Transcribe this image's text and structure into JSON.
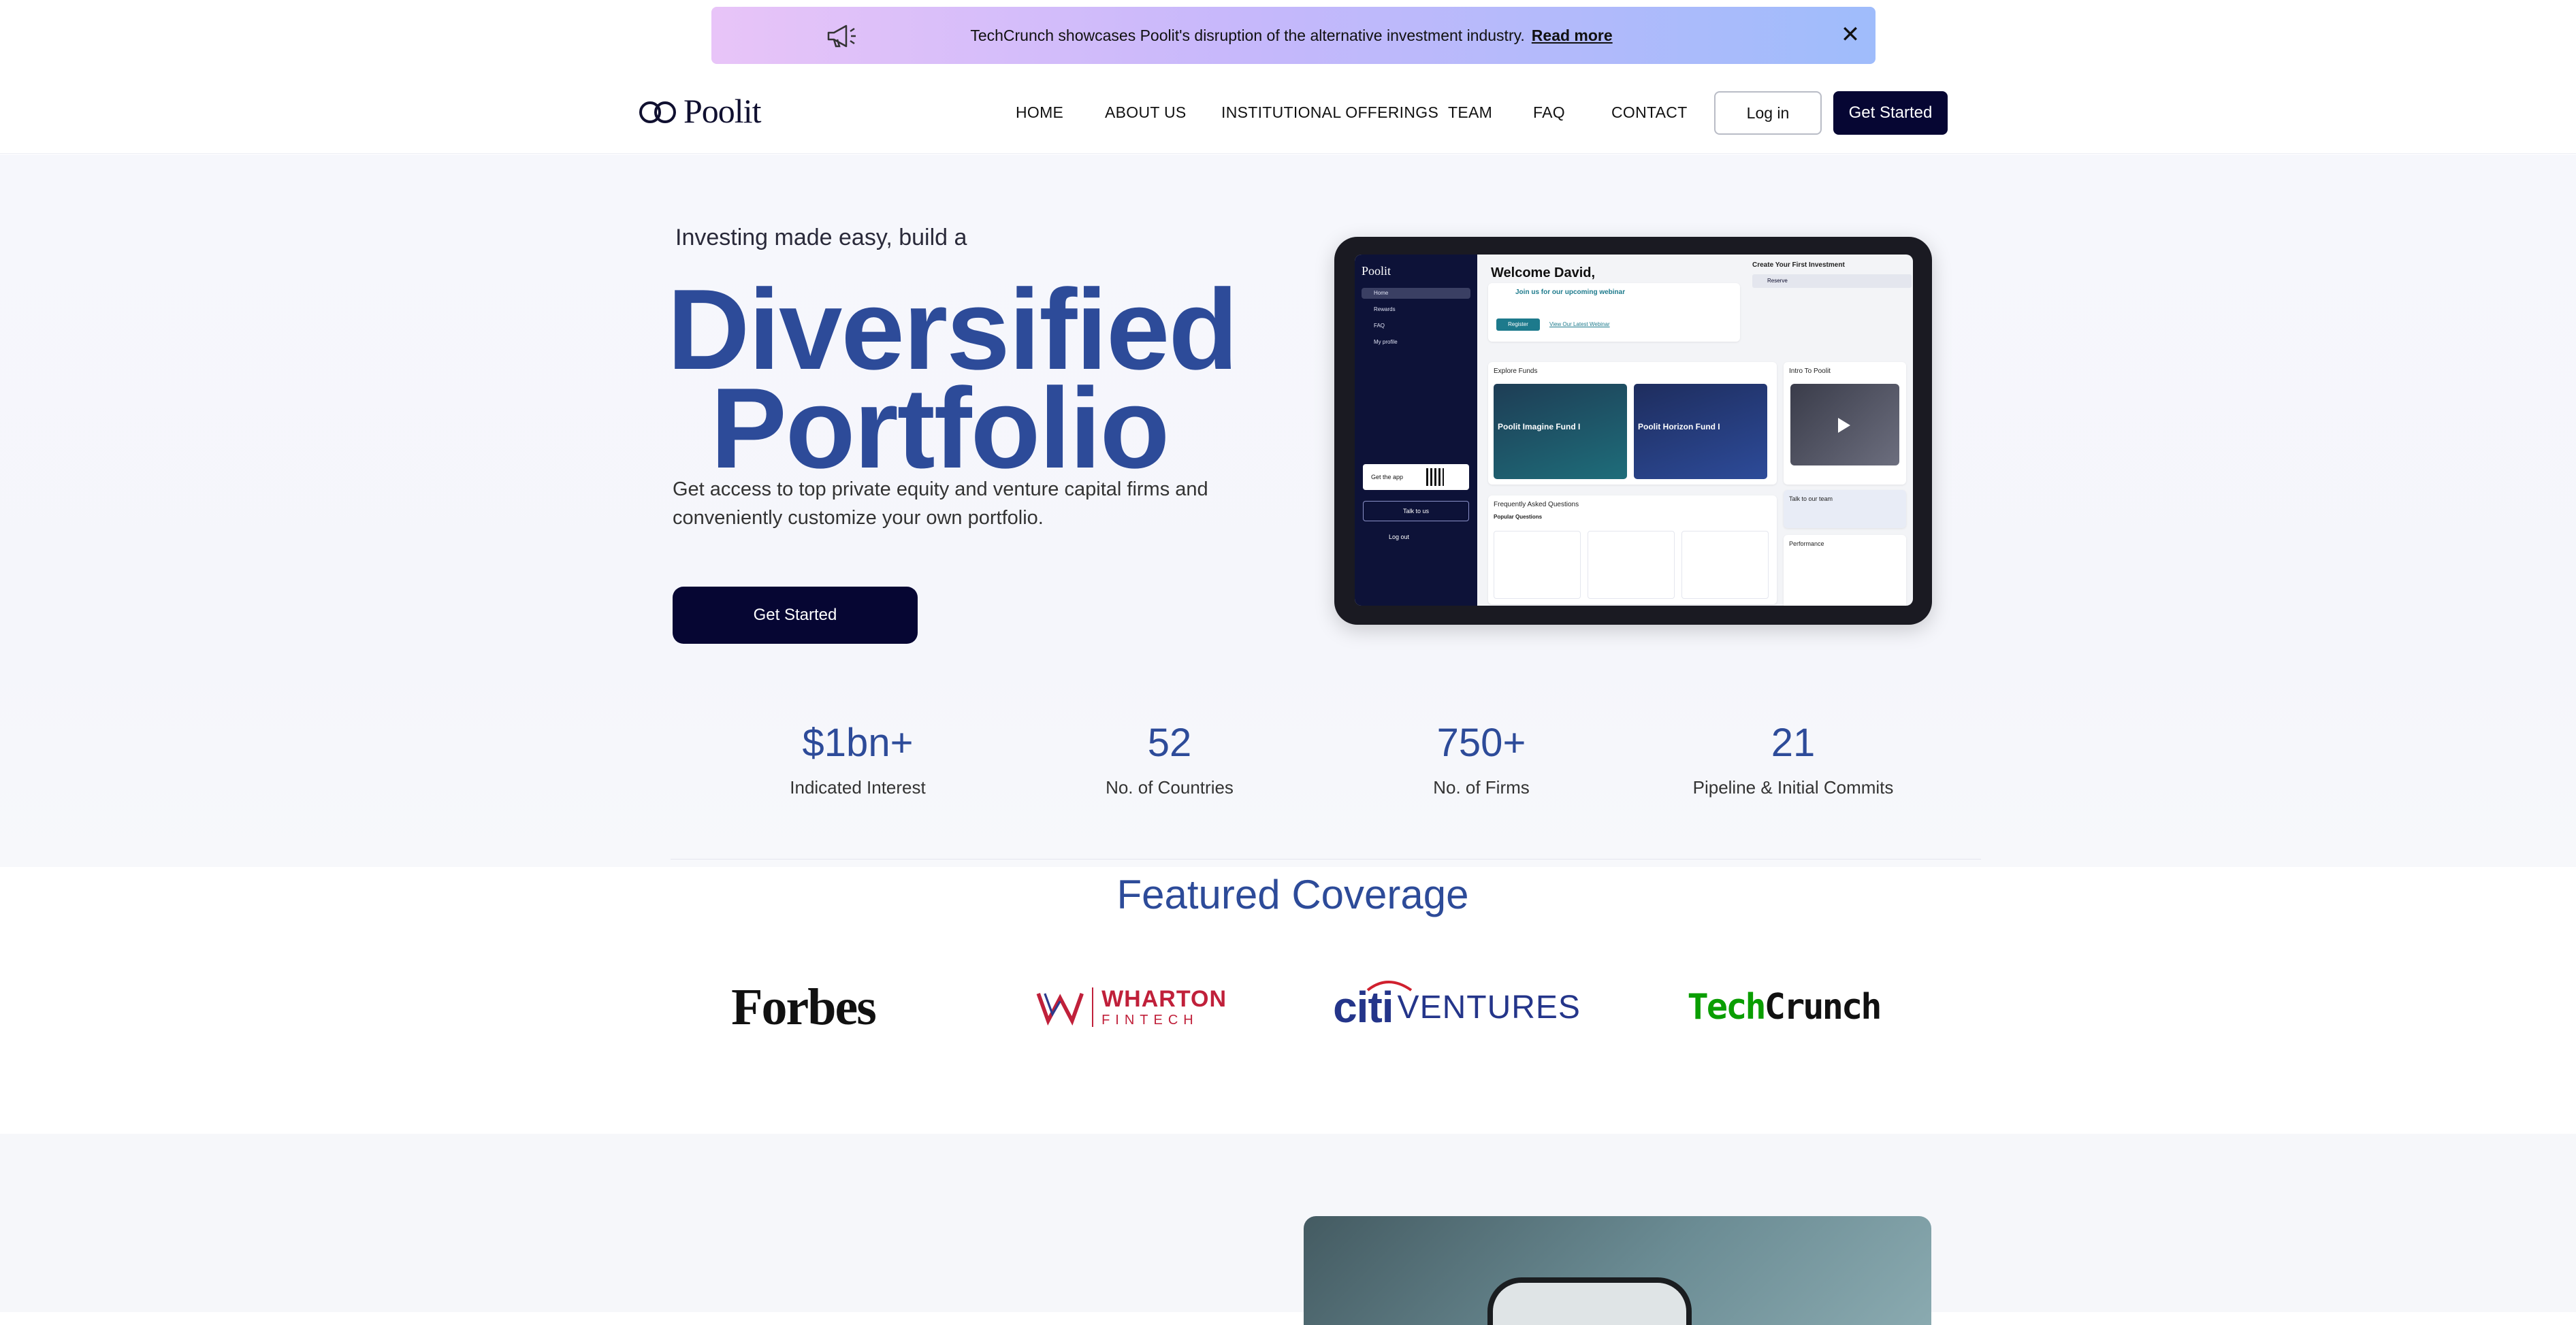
{
  "banner": {
    "text": "TechCrunch showcases Poolit's disruption of the alternative investment industry.",
    "link": "Read more",
    "close": "✕"
  },
  "brand": {
    "name": "Poolit"
  },
  "nav": {
    "items": [
      "HOME",
      "ABOUT US",
      "INSTITUTIONAL OFFERINGS",
      "TEAM",
      "FAQ",
      "CONTACT"
    ],
    "login": "Log in",
    "get_started": "Get Started"
  },
  "hero": {
    "tagline": "Investing made easy, build a",
    "headline_1": "Diversified",
    "headline_2": "Portfolio",
    "description": "Get access to top private equity and venture capital firms and conveniently customize your own portfolio.",
    "cta": "Get Started"
  },
  "mockup": {
    "logo": "Poolit",
    "sidebar": [
      "Home",
      "Rewards",
      "FAQ",
      "My profile"
    ],
    "get_app": "Get the app",
    "talk": "Talk to us",
    "logout": "Log out",
    "welcome": "Welcome David,",
    "webinar": "Join us for our upcoming webinar",
    "register": "Register",
    "view_webinar": "View Our Latest Webinar",
    "create_title": "Create Your First Investment",
    "reserve": "Reserve",
    "explore": "Explore Funds",
    "fund_1": "Poolit Imagine Fund I",
    "fund_2": "Poolit Horizon Fund I",
    "intro": "Intro To Poolit",
    "faq_title": "Frequently Asked Questions",
    "popular": "Popular Questions",
    "talk_team": "Talk to our team",
    "performance": "Performance"
  },
  "stats": [
    {
      "value": "$1bn+",
      "label": "Indicated Interest"
    },
    {
      "value": "52",
      "label": "No. of Countries"
    },
    {
      "value": "750+",
      "label": "No. of Firms"
    },
    {
      "value": "21",
      "label": "Pipeline & Initial Commits"
    }
  ],
  "coverage": {
    "title": "Featured Coverage",
    "logos": {
      "forbes": "Forbes",
      "wharton_1": "WHARTON",
      "wharton_2": "FINTECH",
      "citi_1": "citi",
      "citi_2": "VENTURES",
      "techcrunch_1": "Tech",
      "techcrunch_2": "Crunch"
    }
  },
  "colors": {
    "navy": "#060633",
    "accent_blue": "#2d4b99",
    "banner_left": "#e8c4f8",
    "banner_right": "#9fbcfb",
    "techcrunch_green": "#0a9e01",
    "wharton_red": "#c0203a"
  }
}
